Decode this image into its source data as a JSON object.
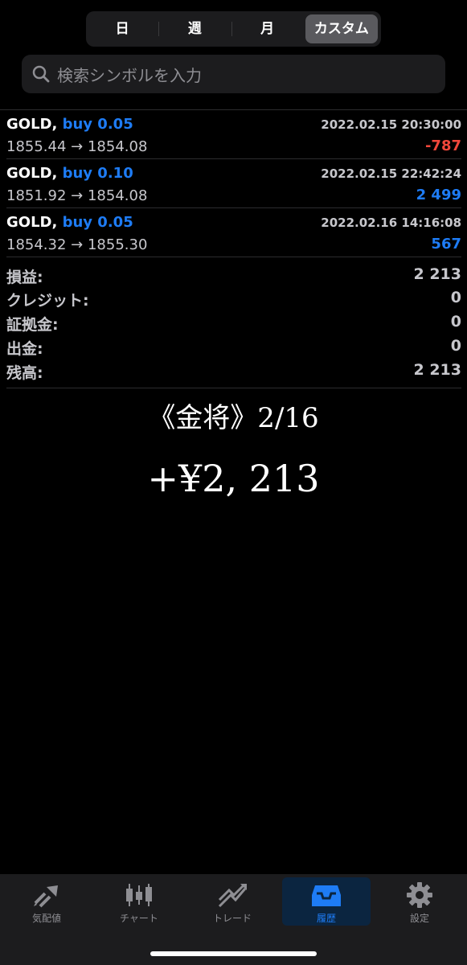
{
  "tabs": {
    "day": "日",
    "week": "週",
    "month": "月",
    "custom": "カスタム"
  },
  "search": {
    "placeholder": "検索シンボルを入力"
  },
  "deals": [
    {
      "symbol": "GOLD,",
      "side": "buy 0.05",
      "datetime": "2022.02.15 20:30:00",
      "prices": "1855.44 → 1854.08",
      "profit": "-787",
      "profit_color": "#f0473b"
    },
    {
      "symbol": "GOLD,",
      "side": "buy 0.10",
      "datetime": "2022.02.15 22:42:24",
      "prices": "1851.92 → 1854.08",
      "profit": "2 499",
      "profit_color": "#1e7cf5"
    },
    {
      "symbol": "GOLD,",
      "side": "buy 0.05",
      "datetime": "2022.02.16 14:16:08",
      "prices": "1854.32 → 1855.30",
      "profit": "567",
      "profit_color": "#1e7cf5"
    }
  ],
  "summary": [
    {
      "label": "損益:",
      "value": "2 213"
    },
    {
      "label": "クレジット:",
      "value": "0"
    },
    {
      "label": "証拠金:",
      "value": "0"
    },
    {
      "label": "出金:",
      "value": "0"
    },
    {
      "label": "残高:",
      "value": "2 213"
    }
  ],
  "overlay": {
    "title": "《金将》2/16",
    "amount": "+¥2, 213"
  },
  "nav": [
    {
      "label": "気配値",
      "icon": "quotes-arrows-icon"
    },
    {
      "label": "チャート",
      "icon": "candlestick-icon"
    },
    {
      "label": "トレード",
      "icon": "trade-trend-icon"
    },
    {
      "label": "履歴",
      "icon": "inbox-history-icon",
      "active": true
    },
    {
      "label": "設定",
      "icon": "gear-icon"
    }
  ]
}
